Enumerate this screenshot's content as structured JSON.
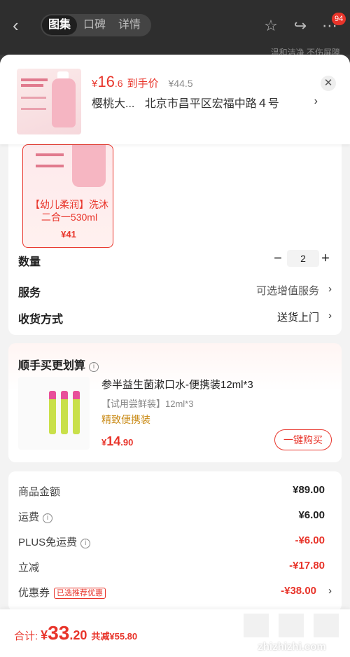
{
  "header": {
    "tabs": [
      "图集",
      "口碑",
      "详情"
    ],
    "active_tab": "图集",
    "badge_count": "94",
    "bg_text": "温和洁净 不伤屏障"
  },
  "product": {
    "price_yen": "¥",
    "price_int": "16",
    "price_dec": ".6",
    "price_tag": "到手价",
    "orig_price": "¥44.5",
    "name": "樱桃大...",
    "address": "北京市昌平区宏福中路４号",
    "close_icon": "close-icon"
  },
  "spec": {
    "name": "【幼儿柔润】洗沐二合一530ml",
    "price": "¥41"
  },
  "rows": {
    "quantity_label": "数量",
    "quantity_value": "2",
    "minus": "−",
    "plus": "+",
    "service_label": "服务",
    "service_value": "可选增值服务",
    "delivery_label": "收货方式",
    "delivery_value": "送货上门"
  },
  "addon": {
    "title": "顺手买更划算",
    "name": "参半益生菌漱口水-便携装12ml*3",
    "spec": "【试用尝鲜装】12ml*3",
    "tag": "精致便携装",
    "price_yen": "¥",
    "price_int": "14",
    "price_dec": ".90",
    "buy_label": "一键购买"
  },
  "summary": {
    "goods_label": "商品金额",
    "goods_value": "¥89.00",
    "shipping_label": "运费",
    "shipping_value": "¥6.00",
    "plus_label": "PLUS免运费",
    "plus_value": "-¥6.00",
    "discount_label": "立减",
    "discount_value": "-¥17.80",
    "coupon_label": "优惠券",
    "coupon_tag": "已选推荐优惠",
    "coupon_value": "-¥38.00"
  },
  "footer": {
    "total_label": "合计:",
    "total_yen": "¥",
    "total_int": "33",
    "total_dec": ".20",
    "saved": "共减¥55.80"
  },
  "watermark": {
    "text": "zhizhizhi.com"
  },
  "colors": {
    "accent": "#e8342a",
    "gold": "#c98a15"
  }
}
